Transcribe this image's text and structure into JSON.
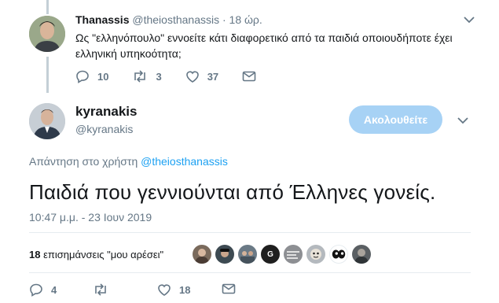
{
  "reply": {
    "name": "Thanassis",
    "handle_time": "@theiosthanassis · 18 ώρ.",
    "text": "Ως \"ελληνόπουλο\" εννοείτε κάτι διαφορετικό από τα παιδιά οποιουδήποτε έχει ελληνική υπηκοότητα;",
    "replies": "10",
    "retweets": "3",
    "likes": "37"
  },
  "tweet": {
    "name": "kyranakis",
    "handle": "@kyranakis",
    "follow_label": "Ακολουθείτε",
    "reply_to_prefix": "Απάντηση στο χρήστη ",
    "reply_to_mention": "@theiosthanassis",
    "text": "Παιδιά που γεννιούνται από Έλληνες γονείς.",
    "timestamp": "10:47 μ.μ. - 23 Ιουν 2019",
    "likes_count": "18",
    "likes_label": "επισημάνσεις \"μου αρέσει\"",
    "replies": "4",
    "retweets": "",
    "likes": "18"
  },
  "liker_avatars": [
    {
      "icon": "avatar-woman",
      "color": "#7a6a5c"
    },
    {
      "icon": "avatar-man-cap",
      "color": "#3d4a52"
    },
    {
      "icon": "avatar-group",
      "color": "#6b7a86"
    },
    {
      "icon": "avatar-g-logo",
      "color": "#1f1f1f",
      "label": "G"
    },
    {
      "icon": "avatar-text-badge",
      "color": "#8d8f93"
    },
    {
      "icon": "avatar-cartoon",
      "color": "#b4b9be"
    },
    {
      "icon": "avatar-eyes",
      "color": "#ffffff"
    },
    {
      "icon": "avatar-dark",
      "color": "#5a5f63"
    }
  ],
  "colors": {
    "accent": "#1da1f2",
    "follow_button": "#a7d2f5",
    "muted": "#657786",
    "text": "#14171a"
  }
}
